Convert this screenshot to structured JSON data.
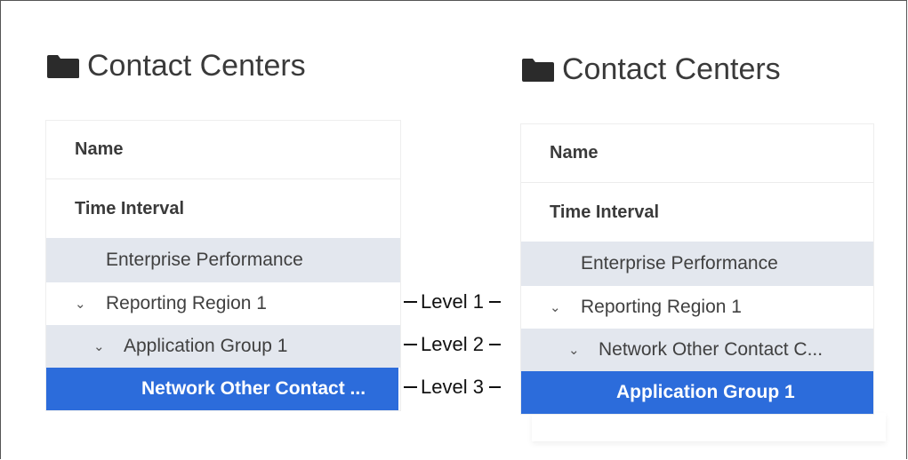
{
  "left_panel": {
    "title": "Contact Centers",
    "header_name": "Name",
    "header_time": "Time Interval",
    "rows": [
      {
        "label": "Enterprise Performance",
        "chevron": ""
      },
      {
        "label": "Reporting Region 1",
        "chevron": "⌄"
      },
      {
        "label": "Application Group 1",
        "chevron": "⌄"
      },
      {
        "label": "Network Other Contact ...",
        "chevron": ""
      }
    ]
  },
  "right_panel": {
    "title": "Contact Centers",
    "header_name": "Name",
    "header_time": "Time Interval",
    "rows": [
      {
        "label": "Enterprise Performance",
        "chevron": ""
      },
      {
        "label": "Reporting Region 1",
        "chevron": "⌄"
      },
      {
        "label": "Network Other Contact C...",
        "chevron": "⌄"
      },
      {
        "label": "Application Group 1",
        "chevron": ""
      }
    ]
  },
  "callouts": [
    "Level 1",
    "Level 2",
    "Level 3"
  ],
  "colors": {
    "selected": "#2c6cdb",
    "row_grey": "#e3e7ee",
    "text": "#404040"
  },
  "icons": {
    "folder": "folder-icon",
    "chevron": "chevron-down-icon"
  }
}
